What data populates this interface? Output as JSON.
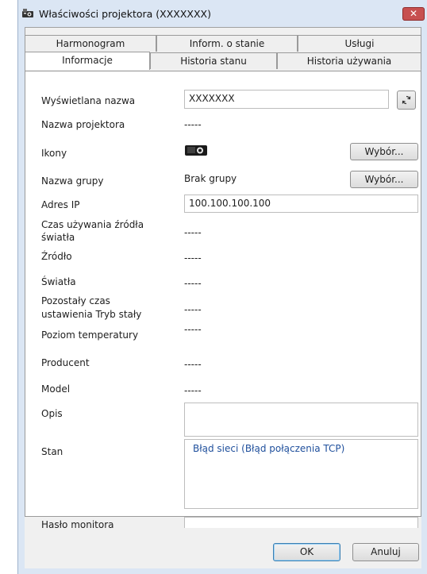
{
  "window": {
    "title": "Właściwości projektora (XXXXXXX)",
    "close_label": "✕"
  },
  "tabs_row1": [
    "Harmonogram",
    "Inform. o stanie",
    "Usługi"
  ],
  "tabs_row2": [
    "Informacje",
    "Historia stanu",
    "Historia używania"
  ],
  "fields": {
    "display_name": {
      "label": "Wyświetlana nazwa",
      "value": "XXXXXXX"
    },
    "projector_name": {
      "label": "Nazwa projektora",
      "value": "-----"
    },
    "icons": {
      "label": "Ikony",
      "button": "Wybór..."
    },
    "group_name": {
      "label": "Nazwa grupy",
      "value": "Brak grupy",
      "button": "Wybór..."
    },
    "ip": {
      "label": "Adres IP",
      "value": "100.100.100.100"
    },
    "lamp_time": {
      "label_line1": "Czas używania źródła",
      "label_line2": "światła",
      "value": "-----"
    },
    "source": {
      "label": "Źródło",
      "value": "-----"
    },
    "lights": {
      "label": "Światła",
      "value": "-----"
    },
    "remaining": {
      "label_line1": "Pozostały czas",
      "label_line2": "ustawienia Tryb stały",
      "value": "-----"
    },
    "temperature": {
      "label": "Poziom temperatury",
      "value": "-----"
    },
    "manufacturer": {
      "label": "Producent",
      "value": "-----"
    },
    "model": {
      "label": "Model",
      "value": "-----"
    },
    "description": {
      "label": "Opis",
      "value": ""
    },
    "status": {
      "label": "Stan",
      "value": "Błąd sieci (Błąd połączenia TCP)"
    },
    "monitor_password": {
      "label": "Hasło monitora",
      "value": ""
    }
  },
  "buttons": {
    "ok": "OK",
    "cancel": "Anuluj"
  },
  "colors": {
    "status_text": "#1f4f9c",
    "window_frame": "#dbe6f4",
    "close_button": "#c75050"
  }
}
